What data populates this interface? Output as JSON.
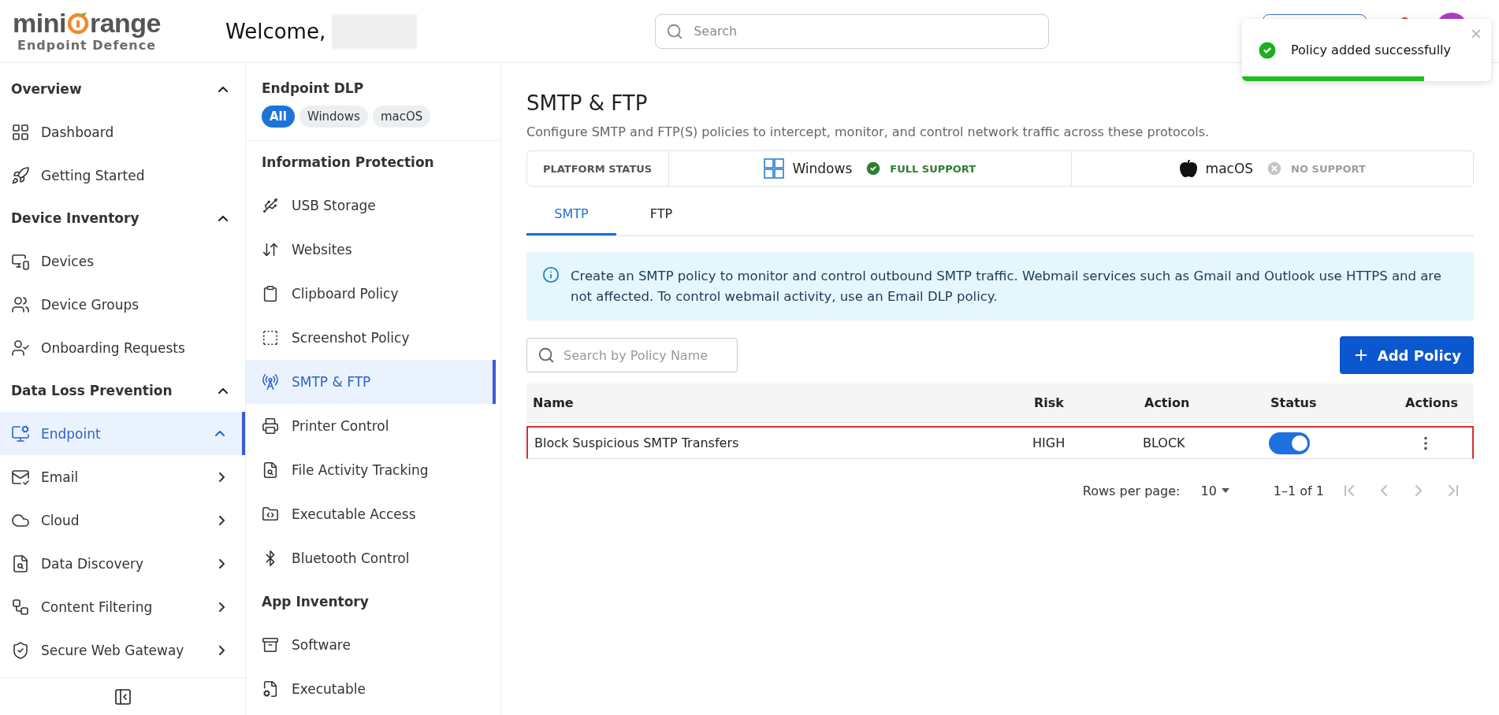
{
  "header": {
    "logo": {
      "brand_left": "mini",
      "brand_right": "range",
      "product": "Endpoint Defence"
    },
    "welcome": "Welcome,",
    "search": {
      "placeholder": "Search"
    }
  },
  "toast": {
    "message": "Policy added successfully",
    "kind": "success",
    "level": 0.73
  },
  "sidebar": {
    "sections": [
      {
        "title": "Overview",
        "expanded": true,
        "items": [
          {
            "label": "Dashboard",
            "selected": false
          },
          {
            "label": "Getting Started",
            "selected": false
          }
        ]
      },
      {
        "title": "Device Inventory",
        "expanded": true,
        "items": [
          {
            "label": "Devices",
            "selected": false
          },
          {
            "label": "Device Groups",
            "selected": false
          },
          {
            "label": "Onboarding Requests",
            "selected": false
          }
        ]
      },
      {
        "title": "Data Loss Prevention",
        "expanded": true,
        "items": [
          {
            "label": "Endpoint",
            "selected": true,
            "expanded": true
          },
          {
            "label": "Email",
            "selected": false,
            "expanded": false
          },
          {
            "label": "Cloud",
            "selected": false,
            "expanded": false
          },
          {
            "label": "Data Discovery",
            "selected": false,
            "expanded": false
          },
          {
            "label": "Content Filtering",
            "selected": false,
            "expanded": false
          },
          {
            "label": "Secure Web Gateway",
            "selected": false,
            "expanded": false
          }
        ]
      }
    ]
  },
  "subnav": {
    "title": "Endpoint DLP",
    "filters": [
      {
        "label": "All",
        "selected": true
      },
      {
        "label": "Windows",
        "selected": false
      },
      {
        "label": "macOS",
        "selected": false
      }
    ],
    "groups": [
      {
        "title": "Information Protection",
        "items": [
          {
            "label": "USB Storage",
            "selected": false
          },
          {
            "label": "Websites",
            "selected": false
          },
          {
            "label": "Clipboard Policy",
            "selected": false
          },
          {
            "label": "Screenshot Policy",
            "selected": false
          },
          {
            "label": "SMTP & FTP",
            "selected": true
          },
          {
            "label": "Printer Control",
            "selected": false
          },
          {
            "label": "File Activity Tracking",
            "selected": false
          },
          {
            "label": "Executable Access",
            "selected": false
          },
          {
            "label": "Bluetooth Control",
            "selected": false
          }
        ]
      },
      {
        "title": "App Inventory",
        "items": [
          {
            "label": "Software",
            "selected": false
          },
          {
            "label": "Executable",
            "selected": false
          }
        ]
      }
    ]
  },
  "main": {
    "title": "SMTP & FTP",
    "subtitle": "Configure SMTP and FTP(S) policies to intercept, monitor, and control network traffic across these protocols.",
    "platform_status": {
      "label": "PLATFORM STATUS",
      "platforms": [
        {
          "name": "Windows",
          "kind": "windows",
          "supported": true,
          "badge": "FULL SUPPORT"
        },
        {
          "name": "macOS",
          "kind": "apple",
          "supported": false,
          "badge": "NO SUPPORT"
        }
      ]
    },
    "tabs": [
      {
        "label": "SMTP",
        "selected": true
      },
      {
        "label": "FTP",
        "selected": false
      }
    ],
    "info": "Create an SMTP policy to monitor and control outbound SMTP traffic. Webmail services such as Gmail and Outlook use HTTPS and are not affected. To control webmail activity, use an Email DLP policy.",
    "search": {
      "placeholder": "Search by Policy Name"
    },
    "add_button": "Add Policy",
    "table": {
      "columns": [
        "Name",
        "Risk",
        "Action",
        "Status",
        "Actions"
      ],
      "rows": [
        {
          "name": "Block Suspicious SMTP Transfers",
          "risk": "HIGH",
          "action": "BLOCK",
          "status_on": true,
          "highlighted": true
        }
      ]
    },
    "pagination": {
      "rows_label": "Rows per page:",
      "rows_value": "10",
      "range": "1–1 of 1",
      "first_disabled": true,
      "prev_disabled": true,
      "next_disabled": true,
      "last_disabled": true
    }
  }
}
